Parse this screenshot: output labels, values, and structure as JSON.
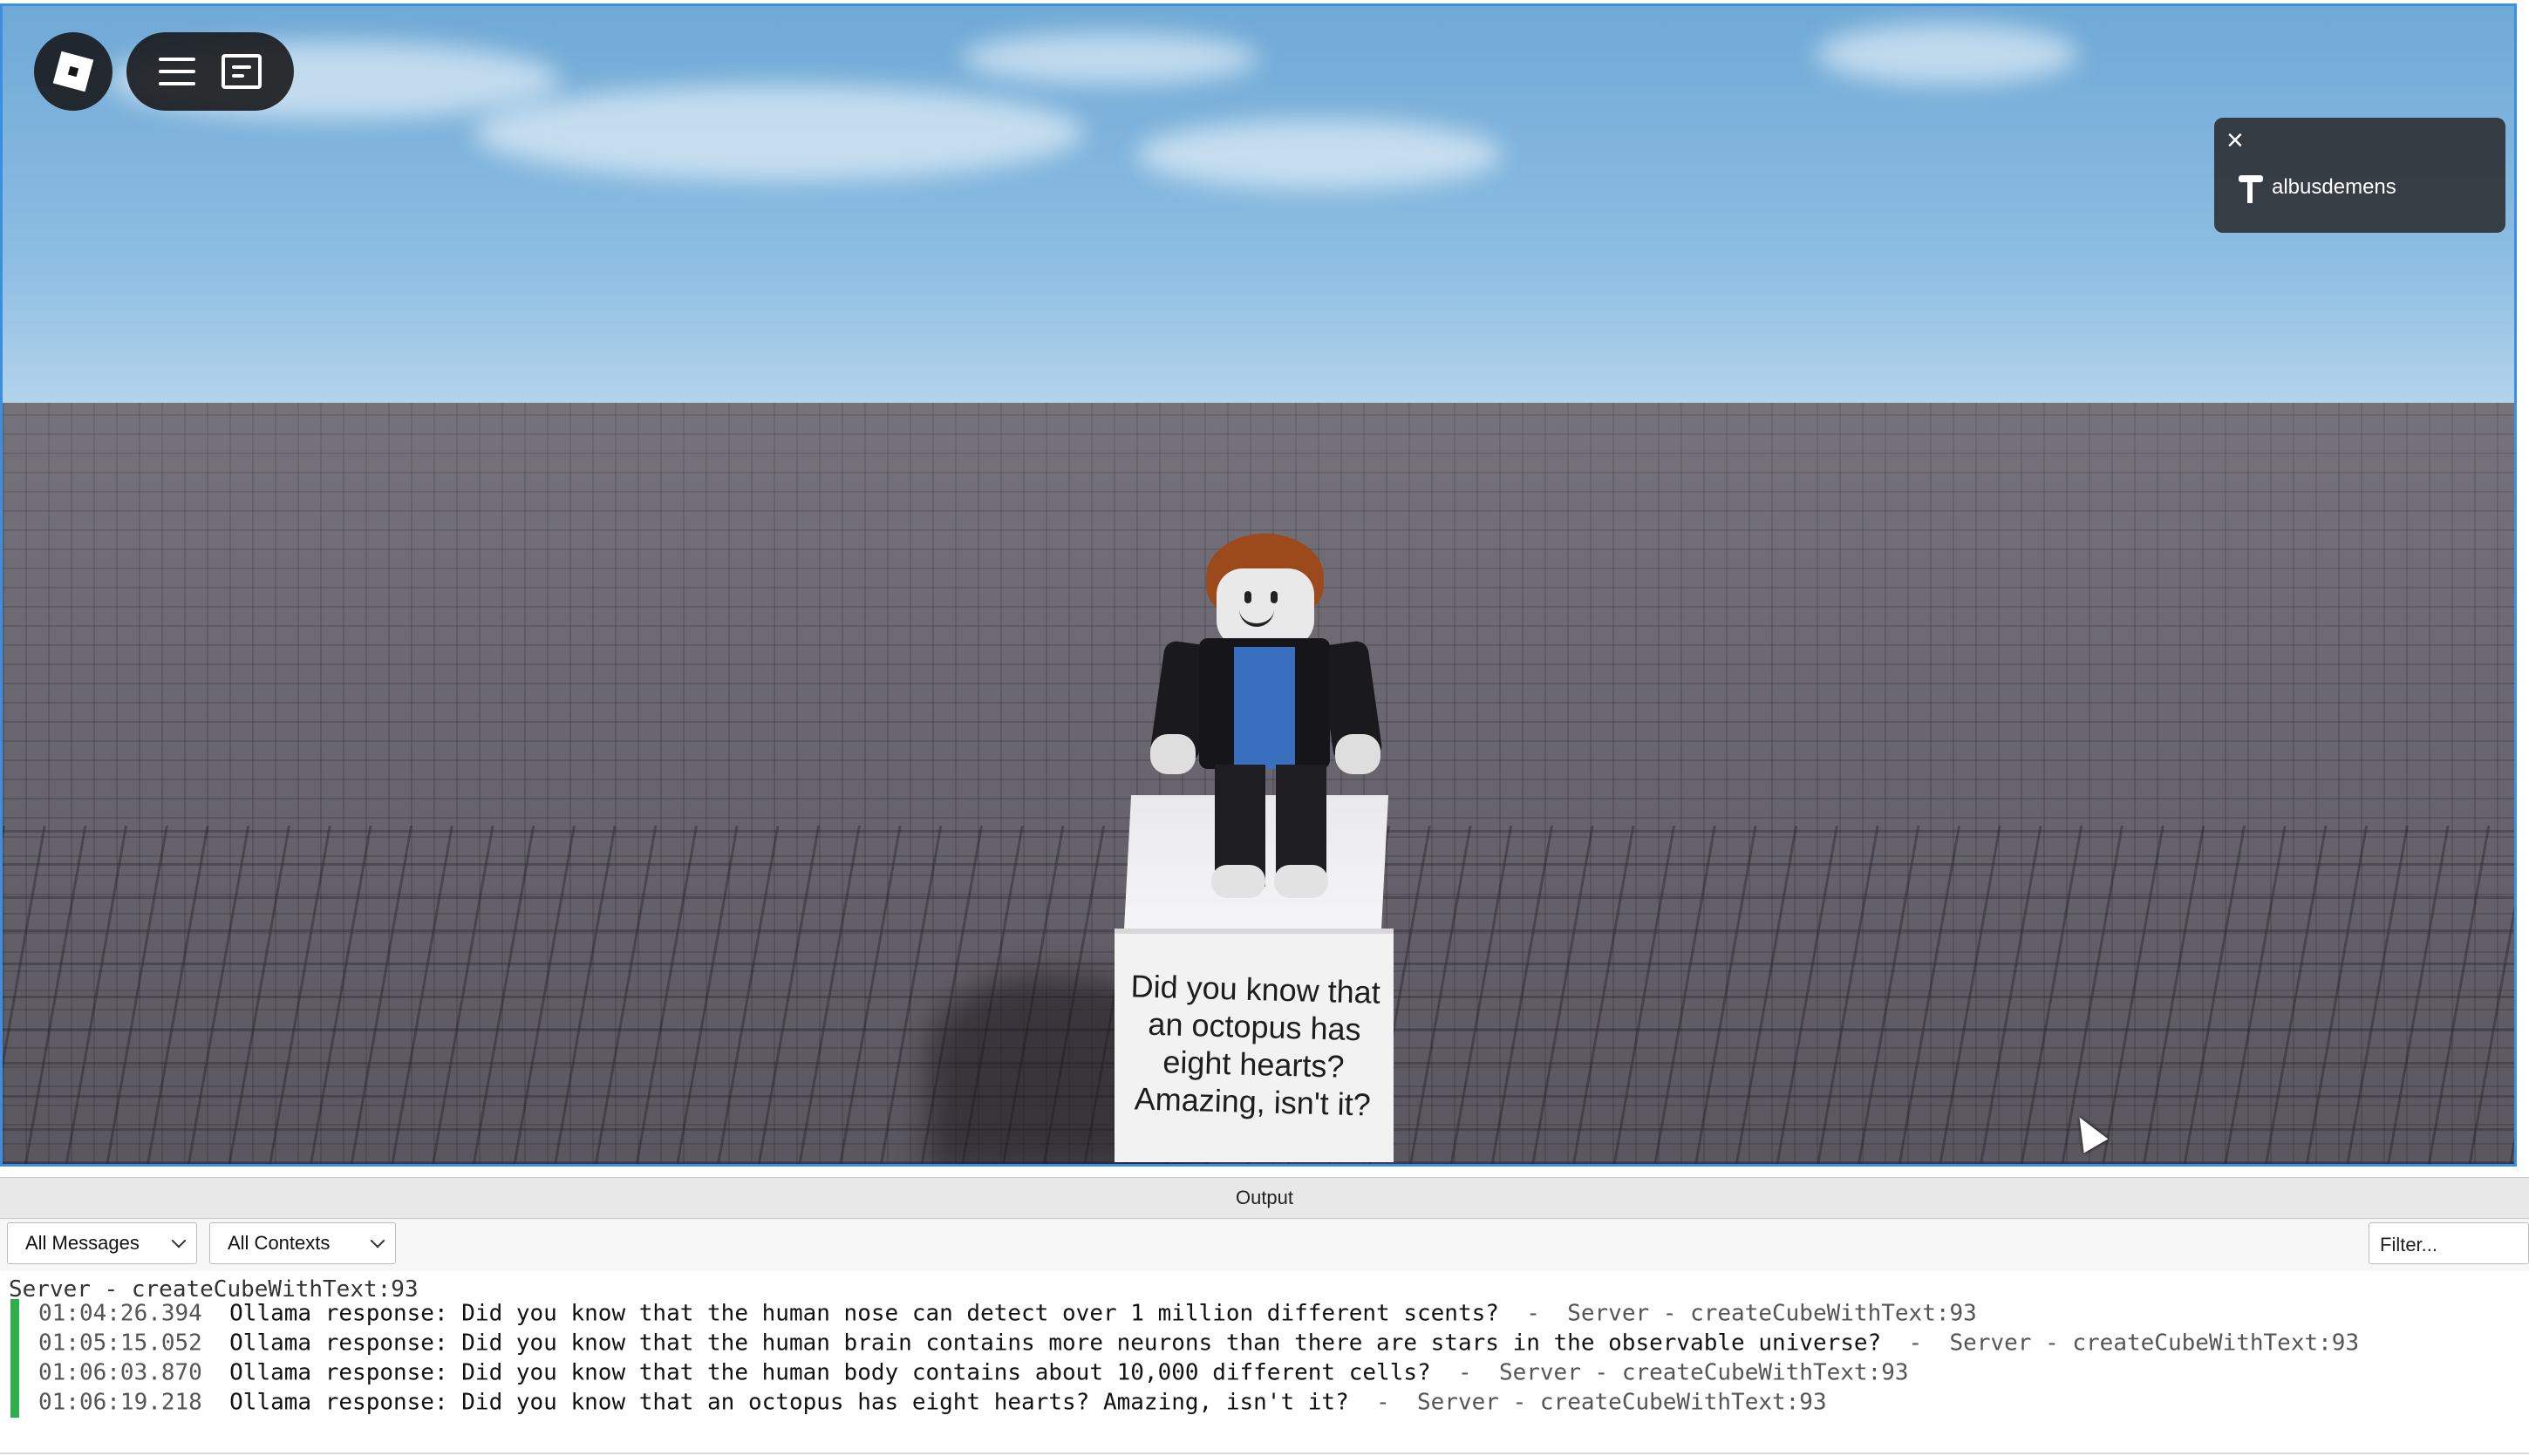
{
  "game": {
    "player_name": "albusdemens",
    "cube_text": "Did you know that an octopus has eight hearts? Amazing, isn't it?"
  },
  "output_panel": {
    "title": "Output",
    "messages_filter": "All Messages",
    "contexts_filter": "All Contexts",
    "filter_placeholder": "Filter...",
    "first_line": "Server - createCubeWithText:93",
    "entries": [
      {
        "time": "01:04:26.394",
        "message": "Ollama response: Did you know that the human nose can detect over 1 million different scents?",
        "source": "Server - createCubeWithText:93"
      },
      {
        "time": "01:05:15.052",
        "message": "Ollama response: Did you know that the human brain contains more neurons than there are stars in the observable universe?",
        "source": "Server - createCubeWithText:93"
      },
      {
        "time": "01:06:03.870",
        "message": "Ollama response: Did you know that the human body contains about 10,000 different cells?",
        "source": "Server - createCubeWithText:93"
      },
      {
        "time": "01:06:19.218",
        "message": "Ollama response: Did you know that an octopus has eight hearts? Amazing, isn't it?",
        "source": "Server - createCubeWithText:93"
      }
    ]
  },
  "icons": [
    "roblox-logo-icon",
    "hamburger-menu-icon",
    "chat-icon",
    "close-icon",
    "hammer-icon",
    "cursor-icon",
    "chevron-down-icon"
  ],
  "colors": {
    "viewport_border": "#3b8fe0",
    "log_marker": "#2db04c"
  }
}
